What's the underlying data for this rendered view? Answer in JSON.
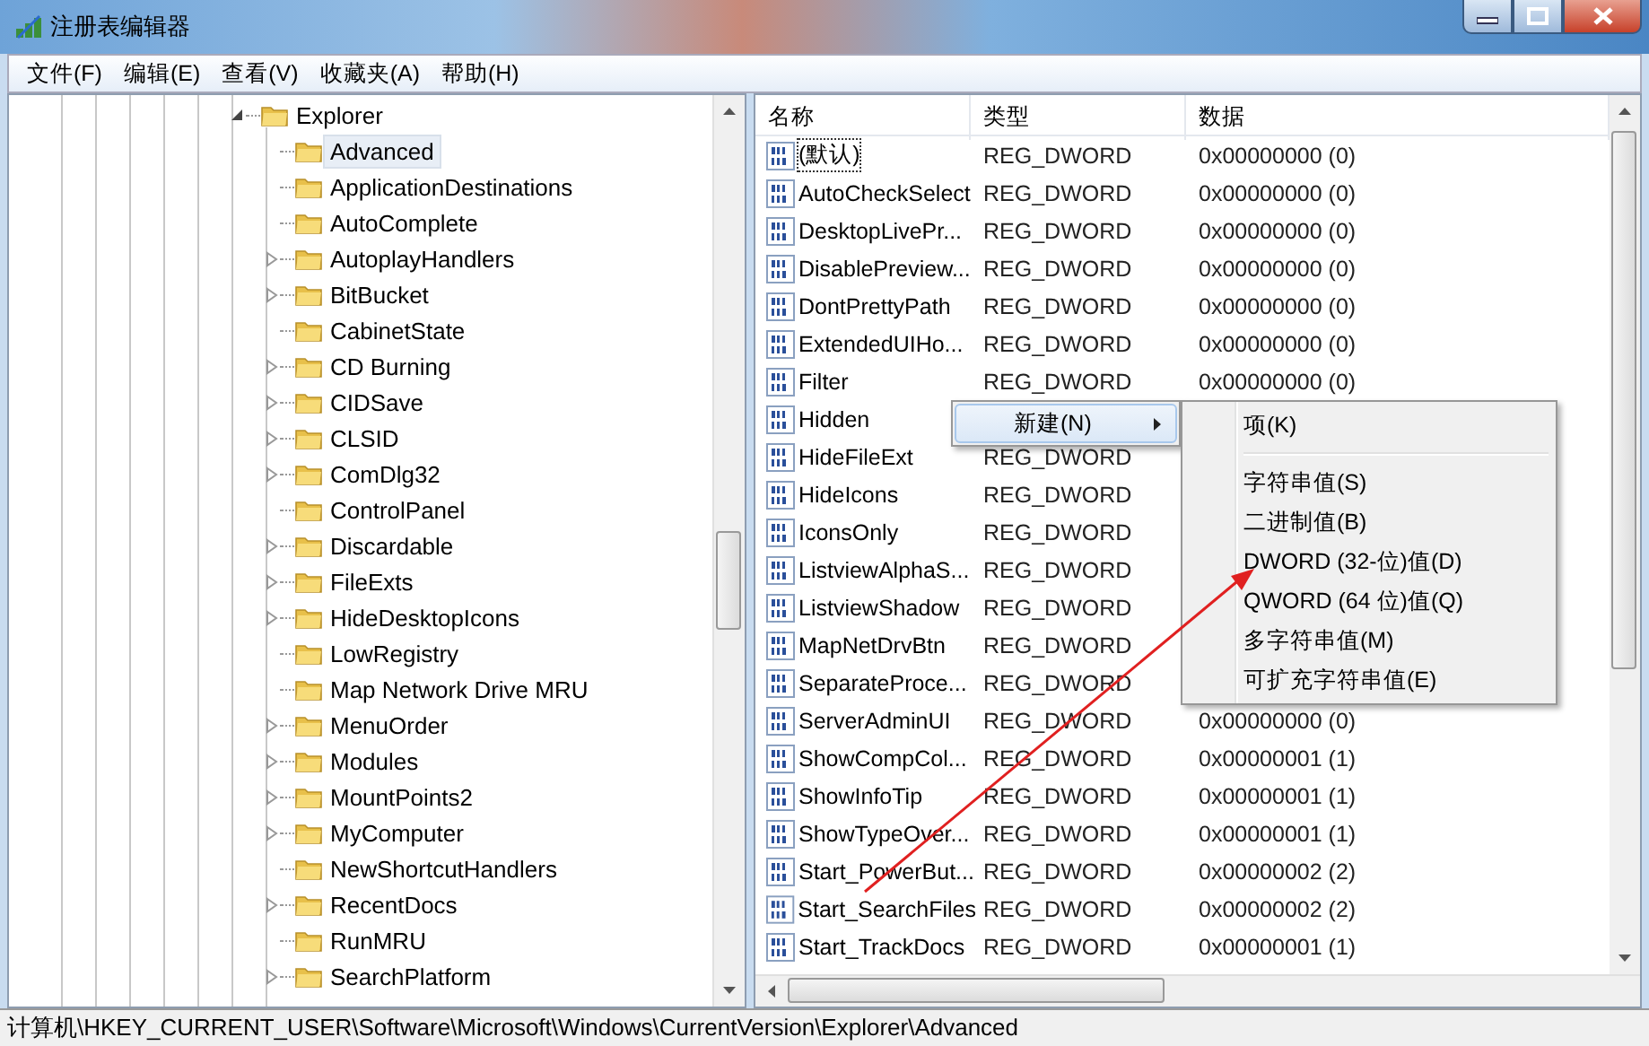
{
  "window": {
    "title": "注册表编辑器"
  },
  "menu_bar": [
    "文件(F)",
    "编辑(E)",
    "查看(V)",
    "收藏夹(A)",
    "帮助(H)"
  ],
  "tree": {
    "items": [
      {
        "label": "Explorer",
        "expanded": true,
        "selected": false,
        "children": [
          {
            "label": "Advanced",
            "expandable": false,
            "selected": true
          },
          {
            "label": "ApplicationDestinations",
            "expandable": false,
            "selected": false
          },
          {
            "label": "AutoComplete",
            "expandable": false,
            "selected": false
          },
          {
            "label": "AutoplayHandlers",
            "expandable": true,
            "selected": false
          },
          {
            "label": "BitBucket",
            "expandable": true,
            "selected": false
          },
          {
            "label": "CabinetState",
            "expandable": false,
            "selected": false
          },
          {
            "label": "CD Burning",
            "expandable": true,
            "selected": false
          },
          {
            "label": "CIDSave",
            "expandable": true,
            "selected": false
          },
          {
            "label": "CLSID",
            "expandable": true,
            "selected": false
          },
          {
            "label": "ComDlg32",
            "expandable": true,
            "selected": false
          },
          {
            "label": "ControlPanel",
            "expandable": false,
            "selected": false
          },
          {
            "label": "Discardable",
            "expandable": true,
            "selected": false
          },
          {
            "label": "FileExts",
            "expandable": true,
            "selected": false
          },
          {
            "label": "HideDesktopIcons",
            "expandable": true,
            "selected": false
          },
          {
            "label": "LowRegistry",
            "expandable": false,
            "selected": false
          },
          {
            "label": "Map Network Drive MRU",
            "expandable": false,
            "selected": false
          },
          {
            "label": "MenuOrder",
            "expandable": true,
            "selected": false
          },
          {
            "label": "Modules",
            "expandable": true,
            "selected": false
          },
          {
            "label": "MountPoints2",
            "expandable": true,
            "selected": false
          },
          {
            "label": "MyComputer",
            "expandable": true,
            "selected": false
          },
          {
            "label": "NewShortcutHandlers",
            "expandable": false,
            "selected": false
          },
          {
            "label": "RecentDocs",
            "expandable": true,
            "selected": false
          },
          {
            "label": "RunMRU",
            "expandable": false,
            "selected": false
          },
          {
            "label": "SearchPlatform",
            "expandable": true,
            "selected": false
          }
        ]
      }
    ]
  },
  "list": {
    "columns": [
      "名称",
      "类型",
      "数据"
    ],
    "rows": [
      {
        "name": "(默认)",
        "type": "REG_DWORD",
        "data": "0x00000000 (0)",
        "focused": true
      },
      {
        "name": "AutoCheckSelect",
        "type": "REG_DWORD",
        "data": "0x00000000 (0)",
        "focused": false
      },
      {
        "name": "DesktopLivePr...",
        "type": "REG_DWORD",
        "data": "0x00000000 (0)",
        "focused": false
      },
      {
        "name": "DisablePreview...",
        "type": "REG_DWORD",
        "data": "0x00000000 (0)",
        "focused": false
      },
      {
        "name": "DontPrettyPath",
        "type": "REG_DWORD",
        "data": "0x00000000 (0)",
        "focused": false
      },
      {
        "name": "ExtendedUIHo...",
        "type": "REG_DWORD",
        "data": "0x00000000 (0)",
        "focused": false
      },
      {
        "name": "Filter",
        "type": "REG_DWORD",
        "data": "0x00000000 (0)",
        "focused": false
      },
      {
        "name": "Hidden",
        "focused": false
      },
      {
        "name": "HideFileExt",
        "type": "REG_DWORD",
        "focused": false
      },
      {
        "name": "HideIcons",
        "type": "REG_DWORD",
        "focused": false
      },
      {
        "name": "IconsOnly",
        "type": "REG_DWORD",
        "focused": false
      },
      {
        "name": "ListviewAlphaS...",
        "type": "REG_DWORD",
        "focused": false
      },
      {
        "name": "ListviewShadow",
        "type": "REG_DWORD",
        "focused": false
      },
      {
        "name": "MapNetDrvBtn",
        "type": "REG_DWORD",
        "focused": false
      },
      {
        "name": "SeparateProce...",
        "type": "REG_DWORD",
        "focused": false
      },
      {
        "name": "ServerAdminUI",
        "type": "REG_DWORD",
        "data": "0x00000000 (0)",
        "focused": false
      },
      {
        "name": "ShowCompCol...",
        "type": "REG_DWORD",
        "data": "0x00000001 (1)",
        "focused": false
      },
      {
        "name": "ShowInfoTip",
        "type": "REG_DWORD",
        "data": "0x00000001 (1)",
        "focused": false
      },
      {
        "name": "ShowTypeOver...",
        "type": "REG_DWORD",
        "data": "0x00000001 (1)",
        "focused": false
      },
      {
        "name": "Start_PowerBut...",
        "type": "REG_DWORD",
        "data": "0x00000002 (2)",
        "focused": false
      },
      {
        "name": "Start_SearchFiles",
        "type": "REG_DWORD",
        "data": "0x00000002 (2)",
        "focused": false
      },
      {
        "name": "Start_TrackDocs",
        "type": "REG_DWORD",
        "data": "0x00000001 (1)",
        "focused": false
      }
    ]
  },
  "context_menu": {
    "items": [
      {
        "label": "新建(N)",
        "highlighted": true,
        "has_submenu": true
      }
    ]
  },
  "submenu": {
    "items": [
      {
        "kind": "item",
        "label": "项(K)"
      },
      {
        "kind": "separator"
      },
      {
        "kind": "item",
        "label": "字符串值(S)"
      },
      {
        "kind": "item",
        "label": "二进制值(B)"
      },
      {
        "kind": "item",
        "label": "DWORD (32-位)值(D)"
      },
      {
        "kind": "item",
        "label": "QWORD (64 位)值(Q)"
      },
      {
        "kind": "item",
        "label": "多字符串值(M)"
      },
      {
        "kind": "item",
        "label": "可扩充字符串值(E)"
      }
    ]
  },
  "status_bar": {
    "path": "计算机\\HKEY_CURRENT_USER\\Software\\Microsoft\\Windows\\CurrentVersion\\Explorer\\Advanced"
  }
}
